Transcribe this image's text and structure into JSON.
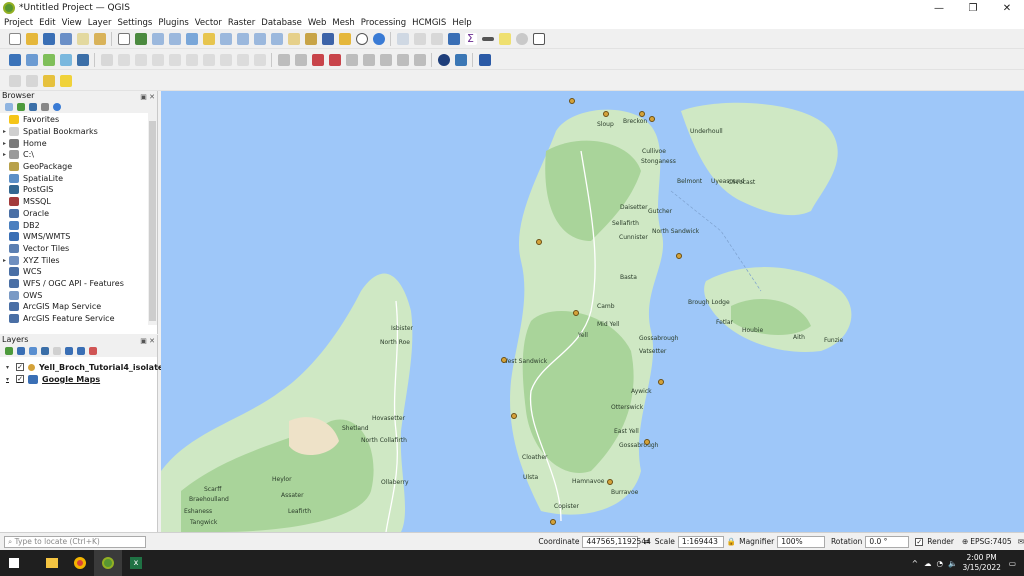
{
  "window": {
    "title": "*Untitled Project — QGIS"
  },
  "menus": [
    "Project",
    "Edit",
    "View",
    "Layer",
    "Settings",
    "Plugins",
    "Vector",
    "Raster",
    "Database",
    "Web",
    "Mesh",
    "Processing",
    "HCMGIS",
    "Help"
  ],
  "browser": {
    "title": "Browser",
    "items": [
      {
        "label": "Favorites",
        "icon": "star-icon",
        "arrow": ""
      },
      {
        "label": "Spatial Bookmarks",
        "icon": "bookmark-icon",
        "arrow": "▸"
      },
      {
        "label": "Home",
        "icon": "home-icon",
        "arrow": "▸"
      },
      {
        "label": "C:\\",
        "icon": "drive-icon",
        "arrow": "▸"
      },
      {
        "label": "GeoPackage",
        "icon": "geopackage-icon",
        "arrow": ""
      },
      {
        "label": "SpatiaLite",
        "icon": "spatialite-icon",
        "arrow": ""
      },
      {
        "label": "PostGIS",
        "icon": "postgis-icon",
        "arrow": ""
      },
      {
        "label": "MSSQL",
        "icon": "mssql-icon",
        "arrow": ""
      },
      {
        "label": "Oracle",
        "icon": "oracle-icon",
        "arrow": ""
      },
      {
        "label": "DB2",
        "icon": "db2-icon",
        "arrow": ""
      },
      {
        "label": "WMS/WMTS",
        "icon": "wms-icon",
        "arrow": ""
      },
      {
        "label": "Vector Tiles",
        "icon": "vector-tiles-icon",
        "arrow": ""
      },
      {
        "label": "XYZ Tiles",
        "icon": "xyz-tiles-icon",
        "arrow": "▸"
      },
      {
        "label": "WCS",
        "icon": "wcs-icon",
        "arrow": ""
      },
      {
        "label": "WFS / OGC API - Features",
        "icon": "wfs-icon",
        "arrow": ""
      },
      {
        "label": "OWS",
        "icon": "ows-icon",
        "arrow": ""
      },
      {
        "label": "ArcGIS Map Service",
        "icon": "arcgis-map-icon",
        "arrow": ""
      },
      {
        "label": "ArcGIS Feature Service",
        "icon": "arcgis-feature-icon",
        "arrow": ""
      }
    ]
  },
  "layers": {
    "title": "Layers",
    "items": [
      {
        "label": "Yell_Broch_Tutorial4_isolatedda",
        "checked": "✓",
        "icon": "point-layer-icon"
      },
      {
        "label": "Google Maps",
        "checked": "✓",
        "icon": "xyz-layer-icon"
      }
    ]
  },
  "map_labels": [
    "Sloup",
    "Breckon",
    "Cullivoe",
    "Underhoull",
    "Stonganess",
    "Belmont",
    "Uyeasound",
    "Clivocast",
    "Daisetter",
    "Sellafirth",
    "Gutcher",
    "Cunnister",
    "North Sandwick",
    "Basta",
    "Gossabrough",
    "Camb",
    "Brough Lodge",
    "Fetlar",
    "Houbie",
    "Aith",
    "Funzie",
    "Mid Yell",
    "Yell",
    "Vatsetter",
    "Aywick",
    "West Sandwick",
    "Otterswick",
    "East Yell",
    "Gossabrough",
    "Ulsta",
    "Hamnavoe",
    "Burravoe",
    "Copister",
    "Cloather",
    "Shetland",
    "North Collafirth",
    "Hovasetter",
    "Ollaberry",
    "North Roe",
    "Isbister",
    "Heylor",
    "Assater",
    "Eshaness",
    "Braehoulland",
    "Tangwick",
    "Scarff",
    "Leafirth"
  ],
  "status": {
    "locate_placeholder": "Type to locate (Ctrl+K)",
    "coordinate_label": "Coordinate",
    "coordinate": "447565,1192544",
    "scale_label": "Scale",
    "scale": "1:169443",
    "magnifier_label": "Magnifier",
    "magnifier": "100%",
    "rotation_label": "Rotation",
    "rotation": "0.0 °",
    "render_label": "Render",
    "crs": "EPSG:7405",
    "render_checked": "✓"
  },
  "taskbar": {
    "time": "2:00 PM",
    "date": "3/15/2022"
  },
  "colors": {
    "water": "#9ec7f9",
    "land": "#cfe8c4",
    "forest": "#a9d49a",
    "qgis_green": "#589632"
  }
}
